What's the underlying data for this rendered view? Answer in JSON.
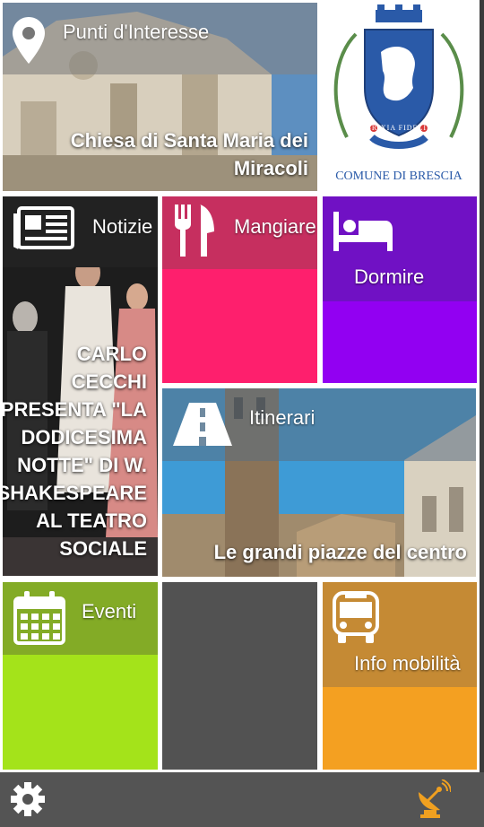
{
  "tiles": {
    "poi": {
      "title": "Punti d'Interesse",
      "caption_line1": "Chiesa di Santa Maria dei",
      "caption_line2": "Miracoli"
    },
    "logo": {
      "text": "COMUNE DI BRESCIA",
      "motto": "BRIXIA FIDELIS"
    },
    "news": {
      "title": "Notizie",
      "caption_lines": [
        "CARLO",
        "CECCHI",
        "PRESENTA \"LA",
        "DODICESIMA",
        "NOTTE\" DI W.",
        "SHAKESPEARE",
        "AL TEATRO",
        "SOCIALE"
      ]
    },
    "eat": {
      "title": "Mangiare"
    },
    "sleep": {
      "title": "Dormire"
    },
    "routes": {
      "title": "Itinerari",
      "caption": "Le grandi piazze del centro"
    },
    "events": {
      "title": "Eventi"
    },
    "mobility": {
      "title": "Info mobilità"
    }
  },
  "bottom_bar": {
    "settings_icon": "gear-icon",
    "beacon_icon": "satellite-dish-icon"
  },
  "colors": {
    "eat": "#fe1f6d",
    "eat_band": "#c62f5f",
    "sleep": "#9200f2",
    "sleep_band": "#7011c4",
    "events": "#a4e31a",
    "events_band": "#83ab26",
    "mobility": "#f4a021",
    "mobility_band": "#c58a34",
    "empty": "#525252",
    "bar": "#545454",
    "beacon": "#f0a020"
  }
}
